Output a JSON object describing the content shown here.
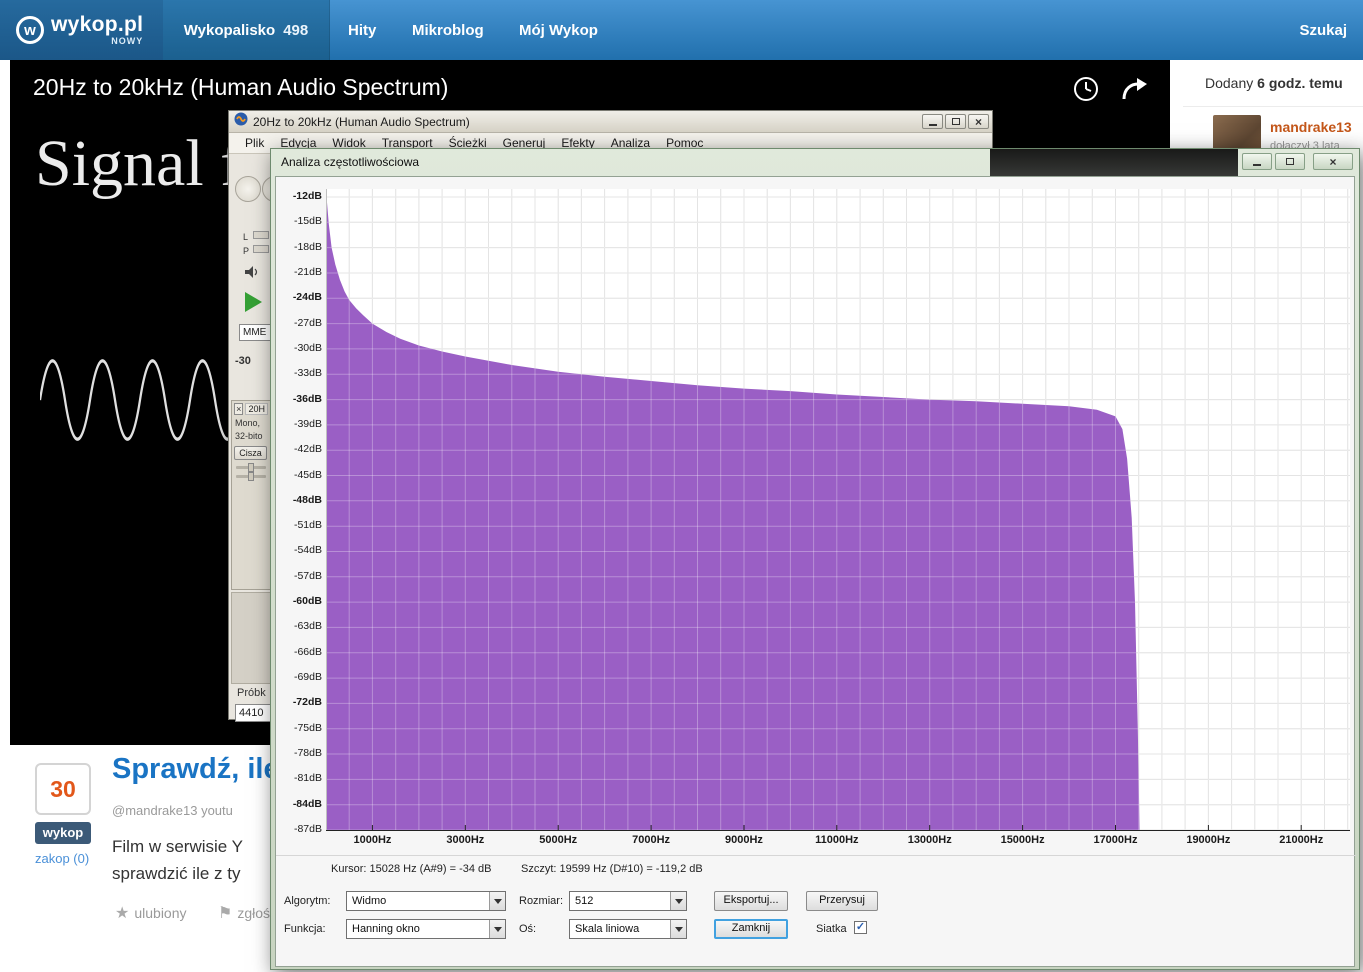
{
  "header": {
    "logo_letter": "w",
    "brand": "wykop.pl",
    "brand_sub": "NOWY",
    "nav": [
      {
        "label": "Wykopalisko",
        "count": "498"
      },
      {
        "label": "Hity"
      },
      {
        "label": "Mikroblog"
      },
      {
        "label": "Mój Wykop"
      }
    ],
    "search_label": "Szukaj"
  },
  "video": {
    "title": "20Hz to 20kHz (Human Audio Spectrum)",
    "overlay_text": "Signal fr"
  },
  "article": {
    "score": "30",
    "dig_label": "wykop",
    "bury_label": "zakop (0)",
    "title": "Sprawdź, ile",
    "meta": "@mandrake13  youtu",
    "body_line1": "Film w serwisie Y",
    "body_line2": "sprawdzić ile z ty",
    "fav_icon": "★",
    "fav_label": "ulubiony",
    "report_icon": "⚑",
    "report_label": "zgłoś"
  },
  "sidebar": {
    "added_prefix": "Dodany",
    "added_time": "6 godz. temu",
    "user_name": "mandrake13",
    "user_joined": "dołączył 3 lata"
  },
  "audacity": {
    "window_title": "20Hz to 20kHz (Human Audio Spectrum)",
    "menus": [
      "Plik",
      "Edycja",
      "Widok",
      "Transport",
      "Ścieżki",
      "Generuj",
      "Efekty",
      "Analiza",
      "Pomoc"
    ],
    "meter_left": "L",
    "meter_right": "P",
    "device": "MME",
    "ruler_value": "-30",
    "track_close": "×",
    "track_name": "20H",
    "track_info1": "Mono,",
    "track_info2": "32-bito",
    "mute_label": "Cisza",
    "status_label": "Próbk",
    "status_value": "4410",
    "close_glyph": "×"
  },
  "freq_window": {
    "title": "Analiza częstotliwościowa",
    "close_glyph": "×",
    "cursor_text": "Kursor: 15028 Hz (A#9) = -34 dB",
    "peak_text": "Szczyt: 19599 Hz (D#10) = -119,2 dB",
    "algorithm_label": "Algorytm:",
    "algorithm_value": "Widmo",
    "size_label": "Rozmiar:",
    "size_value": "512",
    "function_label": "Funkcja:",
    "function_value": "Hanning okno",
    "axis_label": "Oś:",
    "axis_value": "Skala liniowa",
    "export_label": "Eksportuj...",
    "replot_label": "Przerysuj",
    "close_label": "Zamknij",
    "grid_label": "Siatka",
    "grid_check": "✓",
    "grid_checked": true
  },
  "chart_data": {
    "type": "area",
    "title": "Analiza częstotliwościowa",
    "x_unit": "Hz",
    "y_unit": "dB",
    "x_range": [
      0,
      22050
    ],
    "y_range": [
      -90,
      -10
    ],
    "grid": true,
    "grid_step_hz": 500,
    "grid_step_db": 3,
    "fill_color": "#9a5fc5",
    "x_tick_values": [
      1000,
      3000,
      5000,
      7000,
      9000,
      11000,
      13000,
      15000,
      17000,
      19000,
      21000
    ],
    "x_tick_labels": [
      "1000Hz",
      "3000Hz",
      "5000Hz",
      "7000Hz",
      "9000Hz",
      "11000Hz",
      "13000Hz",
      "15000Hz",
      "17000Hz",
      "19000Hz",
      "21000Hz"
    ],
    "y_tick_labels": [
      "-12dB",
      "-15dB",
      "-18dB",
      "-21dB",
      "-24dB",
      "-27dB",
      "-30dB",
      "-33dB",
      "-36dB",
      "-39dB",
      "-42dB",
      "-45dB",
      "-48dB",
      "-51dB",
      "-54dB",
      "-57dB",
      "-60dB",
      "-63dB",
      "-66dB",
      "-69dB",
      "-72dB",
      "-75dB",
      "-78dB",
      "-81dB",
      "-84dB",
      "-87dB"
    ],
    "cursor": {
      "freq_hz": 15028,
      "note": "A#9",
      "level_db": -34
    },
    "peak": {
      "freq_hz": 19599,
      "note": "D#10",
      "level_db": -119.2
    },
    "points": [
      [
        20,
        -12.5
      ],
      [
        60,
        -15.2
      ],
      [
        120,
        -18
      ],
      [
        200,
        -20
      ],
      [
        300,
        -21.8
      ],
      [
        400,
        -23.2
      ],
      [
        500,
        -24.2
      ],
      [
        650,
        -25.2
      ],
      [
        800,
        -26
      ],
      [
        1000,
        -27
      ],
      [
        1300,
        -28
      ],
      [
        1600,
        -28.8
      ],
      [
        2000,
        -29.6
      ],
      [
        2500,
        -30.3
      ],
      [
        3000,
        -30.9
      ],
      [
        4000,
        -31.9
      ],
      [
        5000,
        -32.7
      ],
      [
        6000,
        -33.3
      ],
      [
        7000,
        -33.8
      ],
      [
        8000,
        -34.3
      ],
      [
        9000,
        -34.7
      ],
      [
        10000,
        -35
      ],
      [
        11000,
        -35.4
      ],
      [
        12000,
        -35.7
      ],
      [
        13000,
        -36
      ],
      [
        14000,
        -36.2
      ],
      [
        15000,
        -36.5
      ],
      [
        16000,
        -36.8
      ],
      [
        16600,
        -37.2
      ],
      [
        17000,
        -38
      ],
      [
        17150,
        -39.5
      ],
      [
        17250,
        -43
      ],
      [
        17350,
        -50
      ],
      [
        17420,
        -60
      ],
      [
        17480,
        -75
      ],
      [
        17520,
        -88
      ]
    ]
  }
}
